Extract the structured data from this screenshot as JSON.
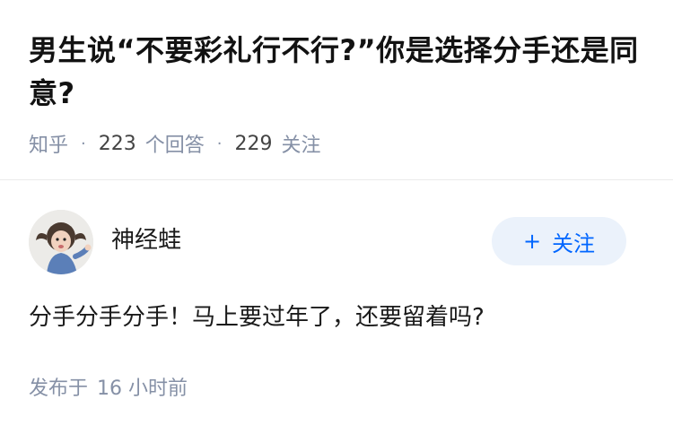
{
  "question": {
    "title": "男生说“不要彩礼行不行?”你是选择分手还是同意?",
    "source": "知乎",
    "answers_count": "223",
    "answers_label": "个回答",
    "follow_count": "229",
    "follow_label": "关注"
  },
  "answer": {
    "author_name": "神经蛙",
    "follow_button": "关注",
    "follow_icon": "plus-icon",
    "content": "分手分手分手！马上要过年了，还要留着吗?",
    "published_label": "发布于",
    "published_time": "16 小时前"
  },
  "colors": {
    "accent": "#0066ff",
    "follow_bg": "#ebf2fb",
    "meta_text": "#8590a6"
  }
}
